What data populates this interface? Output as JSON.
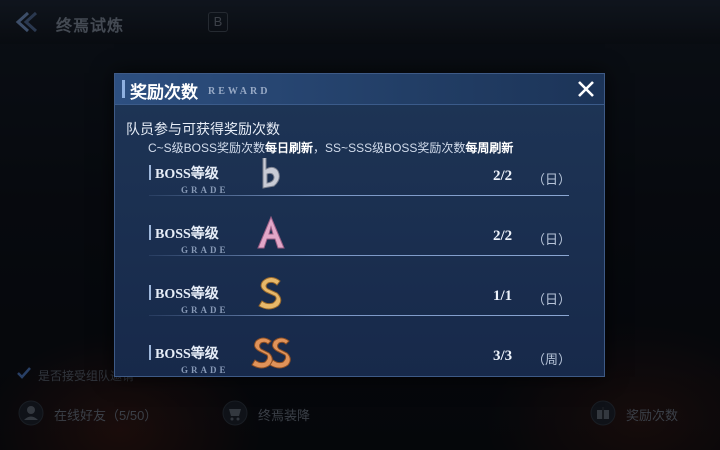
{
  "topbar": {
    "title": "终焉试炼",
    "grade_mark": "B"
  },
  "bottom": {
    "auto_label": "是否接受组队邀请",
    "online_friends": "在线好友（5/50）",
    "end_equipment": "终焉装降",
    "reward_count": "奖励次数"
  },
  "modal": {
    "title": "奖励次数",
    "subtitle": "REWARD",
    "intro": "队员参与可获得奖励次数",
    "rule": {
      "part1": "C~S级BOSS奖励次数",
      "part2": "每日刷新",
      "part3": "，SS~SSS级BOSS奖励次数",
      "part4": "每周刷新"
    },
    "rows": [
      {
        "label": "BOSS等级",
        "sub": "GRADE",
        "grade": "B",
        "count": "2/2",
        "period": "（日）",
        "color": "#c9ccd6"
      },
      {
        "label": "BOSS等级",
        "sub": "GRADE",
        "grade": "A",
        "count": "2/2",
        "period": "（日）",
        "color": "#e2a7c8"
      },
      {
        "label": "BOSS等级",
        "sub": "GRADE",
        "grade": "S",
        "count": "1/1",
        "period": "（日）",
        "color": "#e7b86a"
      },
      {
        "label": "BOSS等级",
        "sub": "GRADE",
        "grade": "SS",
        "count": "3/3",
        "period": "（周）",
        "color": "#e0935a"
      }
    ]
  }
}
